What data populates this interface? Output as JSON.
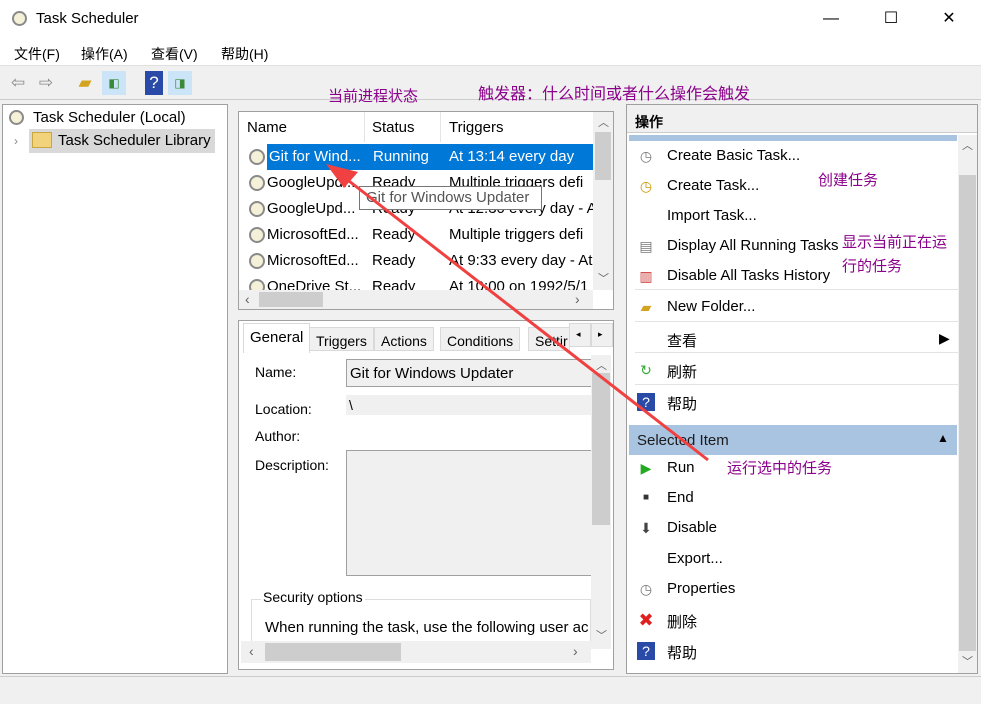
{
  "window": {
    "title": "Task Scheduler",
    "minimize": "—",
    "maximize": "☐",
    "close": "✕"
  },
  "menu": [
    "文件(F)",
    "操作(A)",
    "查看(V)",
    "帮助(H)"
  ],
  "toolbar": [
    "back-icon",
    "forward-icon",
    "up-folder-icon",
    "show-hide-console-tree-icon",
    "help-icon",
    "show-hide-action-pane-icon"
  ],
  "tree": {
    "root": "Task Scheduler (Local)",
    "child": "Task Scheduler Library"
  },
  "task_list": {
    "columns": [
      "Name",
      "Status",
      "Triggers"
    ],
    "rows": [
      {
        "name": "Git for Wind...",
        "status": "Running",
        "triggers": "At 13:14 every day",
        "selected": true
      },
      {
        "name": "GoogleUpd...",
        "status": "Ready",
        "triggers": "Multiple triggers defi"
      },
      {
        "name": "GoogleUpd...",
        "status": "Ready",
        "triggers": "At 12:30 every day - A"
      },
      {
        "name": "MicrosoftEd...",
        "status": "Ready",
        "triggers": "Multiple triggers defi"
      },
      {
        "name": "MicrosoftEd...",
        "status": "Ready",
        "triggers": "At 9:33 every day - At"
      },
      {
        "name": "OneDrive St...",
        "status": "Ready",
        "triggers": "At 10:00 on 1992/5/1"
      }
    ],
    "tooltip": "Git for Windows Updater"
  },
  "details": {
    "tabs": [
      "General",
      "Triggers",
      "Actions",
      "Conditions",
      "Settir"
    ],
    "name_label": "Name:",
    "name_value": "Git for Windows Updater",
    "location_label": "Location:",
    "location_value": "\\",
    "author_label": "Author:",
    "description_label": "Description:",
    "security_title": "Security options",
    "security_text": "When running the task, use the following user ac"
  },
  "actions": {
    "header": "操作",
    "items": [
      {
        "label": "Create Basic Task...",
        "icon": "create-basic-task-icon"
      },
      {
        "label": "Create Task...",
        "icon": "create-task-icon"
      },
      {
        "label": "Import Task...",
        "icon": ""
      },
      {
        "label": "Display All Running Tasks",
        "icon": "running-tasks-icon"
      },
      {
        "label": "Disable All Tasks History",
        "icon": "history-icon"
      },
      {
        "label": "New Folder...",
        "icon": "new-folder-icon"
      },
      {
        "label": "查看",
        "icon": ""
      },
      {
        "label": "刷新",
        "icon": "refresh-icon"
      },
      {
        "label": "帮助",
        "icon": "help-icon"
      }
    ],
    "selected_header": "Selected Item",
    "selected_items": [
      {
        "label": "Run",
        "icon": "run-icon"
      },
      {
        "label": "End",
        "icon": "end-icon"
      },
      {
        "label": "Disable",
        "icon": "disable-icon"
      },
      {
        "label": "Export...",
        "icon": ""
      },
      {
        "label": "Properties",
        "icon": "properties-icon"
      },
      {
        "label": "删除",
        "icon": "delete-icon"
      },
      {
        "label": "帮助",
        "icon": "help-icon"
      }
    ]
  },
  "annotations": {
    "status": "当前进程状态",
    "triggers": "触发器：什么时间或者什么操作会触发",
    "create": "创建任务",
    "running1": "显示当前正在运",
    "running2": "行的任务",
    "run": "运行选中的任务",
    "color": "#8b008b",
    "arrow_color": "#f04040"
  }
}
